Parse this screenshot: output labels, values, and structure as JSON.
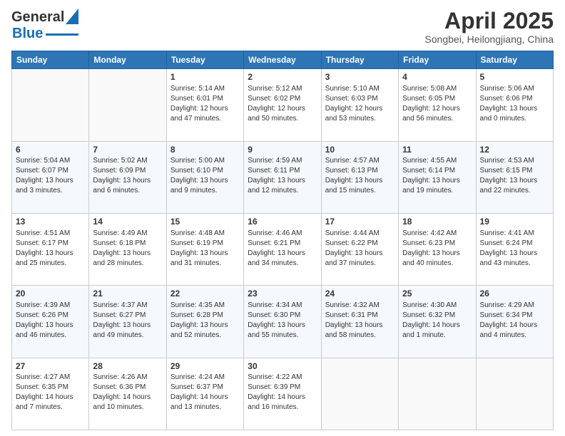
{
  "header": {
    "title": "April 2025",
    "subtitle": "Songbei, Heilongjiang, China",
    "logo_general": "General",
    "logo_blue": "Blue"
  },
  "weekdays": [
    "Sunday",
    "Monday",
    "Tuesday",
    "Wednesday",
    "Thursday",
    "Friday",
    "Saturday"
  ],
  "weeks": [
    [
      {
        "day": "",
        "info": ""
      },
      {
        "day": "",
        "info": ""
      },
      {
        "day": "1",
        "info": "Sunrise: 5:14 AM\nSunset: 6:01 PM\nDaylight: 12 hours and 47 minutes."
      },
      {
        "day": "2",
        "info": "Sunrise: 5:12 AM\nSunset: 6:02 PM\nDaylight: 12 hours and 50 minutes."
      },
      {
        "day": "3",
        "info": "Sunrise: 5:10 AM\nSunset: 6:03 PM\nDaylight: 12 hours and 53 minutes."
      },
      {
        "day": "4",
        "info": "Sunrise: 5:08 AM\nSunset: 6:05 PM\nDaylight: 12 hours and 56 minutes."
      },
      {
        "day": "5",
        "info": "Sunrise: 5:06 AM\nSunset: 6:06 PM\nDaylight: 13 hours and 0 minutes."
      }
    ],
    [
      {
        "day": "6",
        "info": "Sunrise: 5:04 AM\nSunset: 6:07 PM\nDaylight: 13 hours and 3 minutes."
      },
      {
        "day": "7",
        "info": "Sunrise: 5:02 AM\nSunset: 6:09 PM\nDaylight: 13 hours and 6 minutes."
      },
      {
        "day": "8",
        "info": "Sunrise: 5:00 AM\nSunset: 6:10 PM\nDaylight: 13 hours and 9 minutes."
      },
      {
        "day": "9",
        "info": "Sunrise: 4:59 AM\nSunset: 6:11 PM\nDaylight: 13 hours and 12 minutes."
      },
      {
        "day": "10",
        "info": "Sunrise: 4:57 AM\nSunset: 6:13 PM\nDaylight: 13 hours and 15 minutes."
      },
      {
        "day": "11",
        "info": "Sunrise: 4:55 AM\nSunset: 6:14 PM\nDaylight: 13 hours and 19 minutes."
      },
      {
        "day": "12",
        "info": "Sunrise: 4:53 AM\nSunset: 6:15 PM\nDaylight: 13 hours and 22 minutes."
      }
    ],
    [
      {
        "day": "13",
        "info": "Sunrise: 4:51 AM\nSunset: 6:17 PM\nDaylight: 13 hours and 25 minutes."
      },
      {
        "day": "14",
        "info": "Sunrise: 4:49 AM\nSunset: 6:18 PM\nDaylight: 13 hours and 28 minutes."
      },
      {
        "day": "15",
        "info": "Sunrise: 4:48 AM\nSunset: 6:19 PM\nDaylight: 13 hours and 31 minutes."
      },
      {
        "day": "16",
        "info": "Sunrise: 4:46 AM\nSunset: 6:21 PM\nDaylight: 13 hours and 34 minutes."
      },
      {
        "day": "17",
        "info": "Sunrise: 4:44 AM\nSunset: 6:22 PM\nDaylight: 13 hours and 37 minutes."
      },
      {
        "day": "18",
        "info": "Sunrise: 4:42 AM\nSunset: 6:23 PM\nDaylight: 13 hours and 40 minutes."
      },
      {
        "day": "19",
        "info": "Sunrise: 4:41 AM\nSunset: 6:24 PM\nDaylight: 13 hours and 43 minutes."
      }
    ],
    [
      {
        "day": "20",
        "info": "Sunrise: 4:39 AM\nSunset: 6:26 PM\nDaylight: 13 hours and 46 minutes."
      },
      {
        "day": "21",
        "info": "Sunrise: 4:37 AM\nSunset: 6:27 PM\nDaylight: 13 hours and 49 minutes."
      },
      {
        "day": "22",
        "info": "Sunrise: 4:35 AM\nSunset: 6:28 PM\nDaylight: 13 hours and 52 minutes."
      },
      {
        "day": "23",
        "info": "Sunrise: 4:34 AM\nSunset: 6:30 PM\nDaylight: 13 hours and 55 minutes."
      },
      {
        "day": "24",
        "info": "Sunrise: 4:32 AM\nSunset: 6:31 PM\nDaylight: 13 hours and 58 minutes."
      },
      {
        "day": "25",
        "info": "Sunrise: 4:30 AM\nSunset: 6:32 PM\nDaylight: 14 hours and 1 minute."
      },
      {
        "day": "26",
        "info": "Sunrise: 4:29 AM\nSunset: 6:34 PM\nDaylight: 14 hours and 4 minutes."
      }
    ],
    [
      {
        "day": "27",
        "info": "Sunrise: 4:27 AM\nSunset: 6:35 PM\nDaylight: 14 hours and 7 minutes."
      },
      {
        "day": "28",
        "info": "Sunrise: 4:26 AM\nSunset: 6:36 PM\nDaylight: 14 hours and 10 minutes."
      },
      {
        "day": "29",
        "info": "Sunrise: 4:24 AM\nSunset: 6:37 PM\nDaylight: 14 hours and 13 minutes."
      },
      {
        "day": "30",
        "info": "Sunrise: 4:22 AM\nSunset: 6:39 PM\nDaylight: 14 hours and 16 minutes."
      },
      {
        "day": "",
        "info": ""
      },
      {
        "day": "",
        "info": ""
      },
      {
        "day": "",
        "info": ""
      }
    ]
  ]
}
